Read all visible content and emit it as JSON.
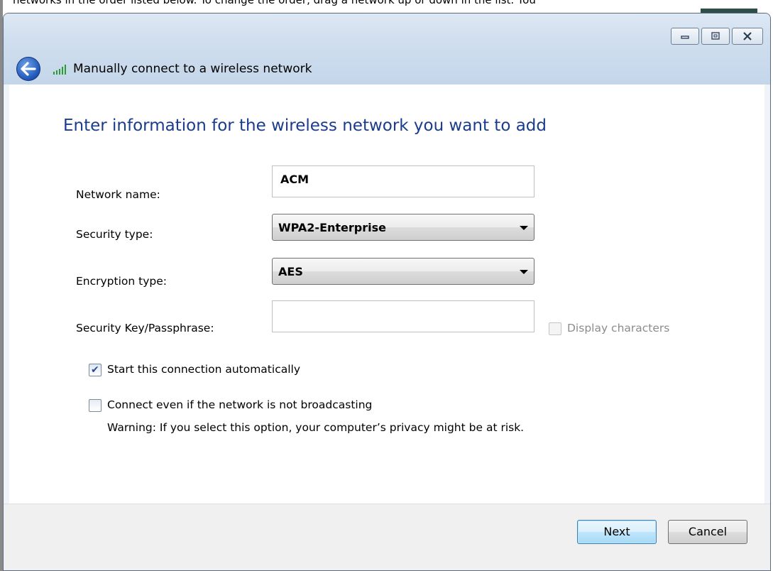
{
  "background_window": {
    "partial_text": "networks in the order listed below. To change the order, drag a network up or down in the list. You"
  },
  "window": {
    "title": "Manually connect to a wireless network",
    "caption": {
      "minimize_icon": "minimize-icon",
      "maximize_icon": "maximize-icon",
      "close_icon": "close-icon"
    }
  },
  "instruction": "Enter information for the wireless network you want to add",
  "form": {
    "network_name": {
      "label": "Network name:",
      "value": "ACM"
    },
    "security_type": {
      "label": "Security type:",
      "value": "WPA2-Enterprise"
    },
    "encryption_type": {
      "label": "Encryption type:",
      "value": "AES"
    },
    "security_key": {
      "label": "Security Key/Passphrase:",
      "value": ""
    },
    "display_characters": {
      "label": "Display characters",
      "checked": false,
      "enabled": false
    },
    "start_automatically": {
      "label": "Start this connection automatically",
      "checked": true
    },
    "connect_not_broadcasting": {
      "label": "Connect even if the network is not broadcasting",
      "checked": false
    },
    "warning": "Warning: If you select this option, your computer’s privacy might be at risk."
  },
  "buttons": {
    "next": "Next",
    "cancel": "Cancel"
  },
  "colors": {
    "instruction_text": "#1a3c8c",
    "frame": "#c4d6ea",
    "footer": "#f0f0f0"
  }
}
